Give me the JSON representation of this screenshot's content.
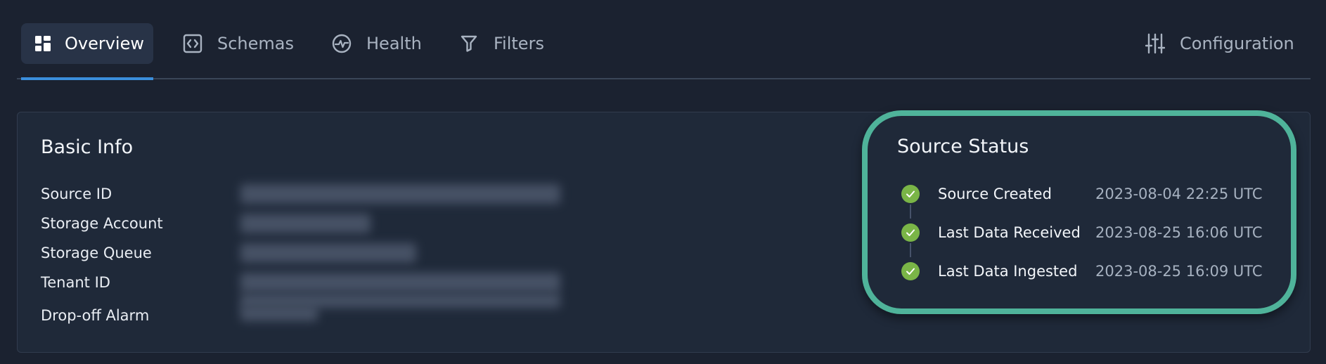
{
  "tabs": [
    {
      "label": "Overview",
      "icon": "grid-icon",
      "active": true
    },
    {
      "label": "Schemas",
      "icon": "code-icon",
      "active": false
    },
    {
      "label": "Health",
      "icon": "pulse-icon",
      "active": false
    },
    {
      "label": "Filters",
      "icon": "filter-icon",
      "active": false
    }
  ],
  "configuration": {
    "label": "Configuration",
    "icon": "sliders-icon"
  },
  "basic_info": {
    "title": "Basic Info",
    "fields": [
      {
        "label": "Source ID"
      },
      {
        "label": "Storage Account"
      },
      {
        "label": "Storage Queue"
      },
      {
        "label": "Tenant ID"
      },
      {
        "label": "Drop-off Alarm"
      }
    ]
  },
  "source_status": {
    "title": "Source Status",
    "events": [
      {
        "label": "Source Created",
        "time": "2023-08-04 22:25 UTC",
        "status": "complete"
      },
      {
        "label": "Last Data Received",
        "time": "2023-08-25 16:06 UTC",
        "status": "complete"
      },
      {
        "label": "Last Data Ingested",
        "time": "2023-08-25 16:09 UTC",
        "status": "complete"
      }
    ]
  },
  "colors": {
    "background": "#1b2230",
    "panel": "#1f2939",
    "active_tab": "#283347",
    "accent_underline": "#3b8fdc",
    "highlight_border": "#4fb39a",
    "check_green": "#7ab547"
  }
}
